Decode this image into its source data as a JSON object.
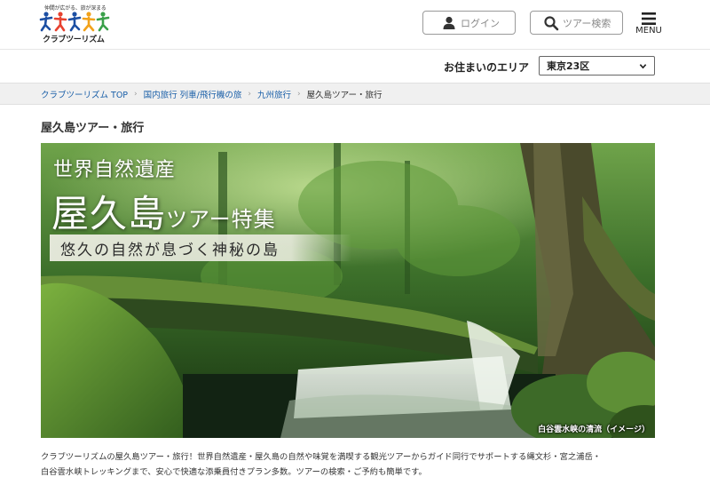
{
  "header": {
    "logo_tagline": "仲間が広がる、旅が深まる",
    "logo_name": "クラブツーリズム",
    "login_label": "ログイン",
    "search_label": "ツアー検索",
    "menu_label": "MENU"
  },
  "area": {
    "label": "お住まいのエリア",
    "selected": "東京23区"
  },
  "breadcrumb": [
    "クラブツーリズム TOP",
    "国内旅行 列車/飛行機の旅",
    "九州旅行",
    "屋久島ツアー・旅行"
  ],
  "page_title": "屋久島ツアー・旅行",
  "hero": {
    "line1": "世界自然遺産",
    "line2_big": "屋久島",
    "line2_small": "ツアー特集",
    "subtitle": "悠久の自然が息づく神秘の島",
    "caption": "白谷雲水峡の清流（イメージ）"
  },
  "description": [
    "クラブツーリズムの屋久島ツアー・旅行！世界自然遺産・屋久島の自然や味覚を満喫する観光ツアーからガイド同行でサポートする縄文杉・宮之浦岳・",
    "白谷雲水峡トレッキングまで、安心で快適な添乗員付きプラン多数。ツアーの検索・ご予約も簡単です。"
  ],
  "colors": {
    "link": "#1a5fa8",
    "crumb_bg": "#f0f0f0",
    "logo_figures": [
      "#1c4fa3",
      "#e7412f",
      "#1c4fa3",
      "#f2a21a",
      "#3aa04a"
    ]
  }
}
